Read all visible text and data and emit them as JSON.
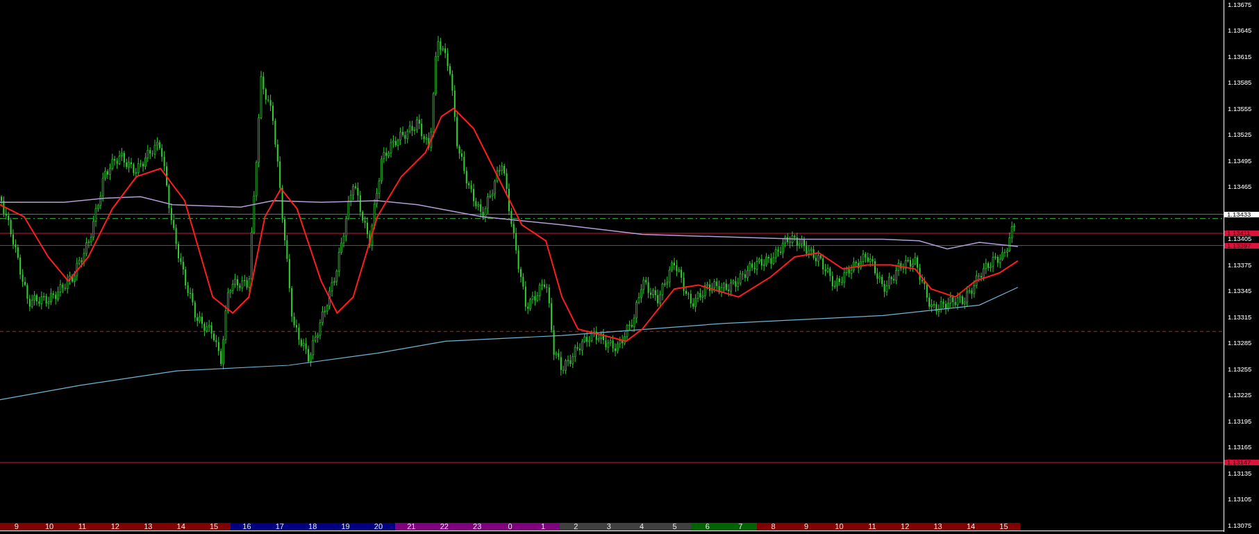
{
  "price_axis": {
    "ticks": [
      "1.13675",
      "1.13645",
      "1.13615",
      "1.13585",
      "1.13555",
      "1.13525",
      "1.13495",
      "1.13465",
      "1.13405",
      "1.13375",
      "1.13345",
      "1.13315",
      "1.13285",
      "1.13255",
      "1.13225",
      "1.13195",
      "1.13165",
      "1.13135",
      "1.13105",
      "1.13075"
    ],
    "markers": [
      {
        "label": "1.13433",
        "kind": "current",
        "color": "#ffffff"
      },
      {
        "label": "1.13411",
        "kind": "level",
        "color": "#dc143c"
      },
      {
        "label": "1.13397",
        "kind": "level",
        "color": "#dc143c"
      },
      {
        "label": "1.13147",
        "kind": "level",
        "color": "#dc143c"
      }
    ]
  },
  "session_bar": [
    {
      "label": "9",
      "color": "#800000"
    },
    {
      "label": "10",
      "color": "#800000"
    },
    {
      "label": "11",
      "color": "#800000"
    },
    {
      "label": "12",
      "color": "#800000"
    },
    {
      "label": "13",
      "color": "#800000"
    },
    {
      "label": "14",
      "color": "#800000"
    },
    {
      "label": "15",
      "color": "#800000"
    },
    {
      "label": "16",
      "color": "#000080"
    },
    {
      "label": "17",
      "color": "#000080"
    },
    {
      "label": "18",
      "color": "#000080"
    },
    {
      "label": "19",
      "color": "#000080"
    },
    {
      "label": "20",
      "color": "#000080"
    },
    {
      "label": "21",
      "color": "#800080"
    },
    {
      "label": "22",
      "color": "#800080"
    },
    {
      "label": "23",
      "color": "#800080"
    },
    {
      "label": "0",
      "color": "#800080"
    },
    {
      "label": "1",
      "color": "#800080"
    },
    {
      "label": "2",
      "color": "#404040"
    },
    {
      "label": "3",
      "color": "#404040"
    },
    {
      "label": "4",
      "color": "#404040"
    },
    {
      "label": "5",
      "color": "#404040"
    },
    {
      "label": "6",
      "color": "#006400"
    },
    {
      "label": "7",
      "color": "#006400"
    },
    {
      "label": "8",
      "color": "#800000"
    },
    {
      "label": "9",
      "color": "#800000"
    },
    {
      "label": "10",
      "color": "#800000"
    },
    {
      "label": "11",
      "color": "#800000"
    },
    {
      "label": "12",
      "color": "#800000"
    },
    {
      "label": "13",
      "color": "#800000"
    },
    {
      "label": "14",
      "color": "#800000"
    },
    {
      "label": "15",
      "color": "#800000"
    }
  ]
}
